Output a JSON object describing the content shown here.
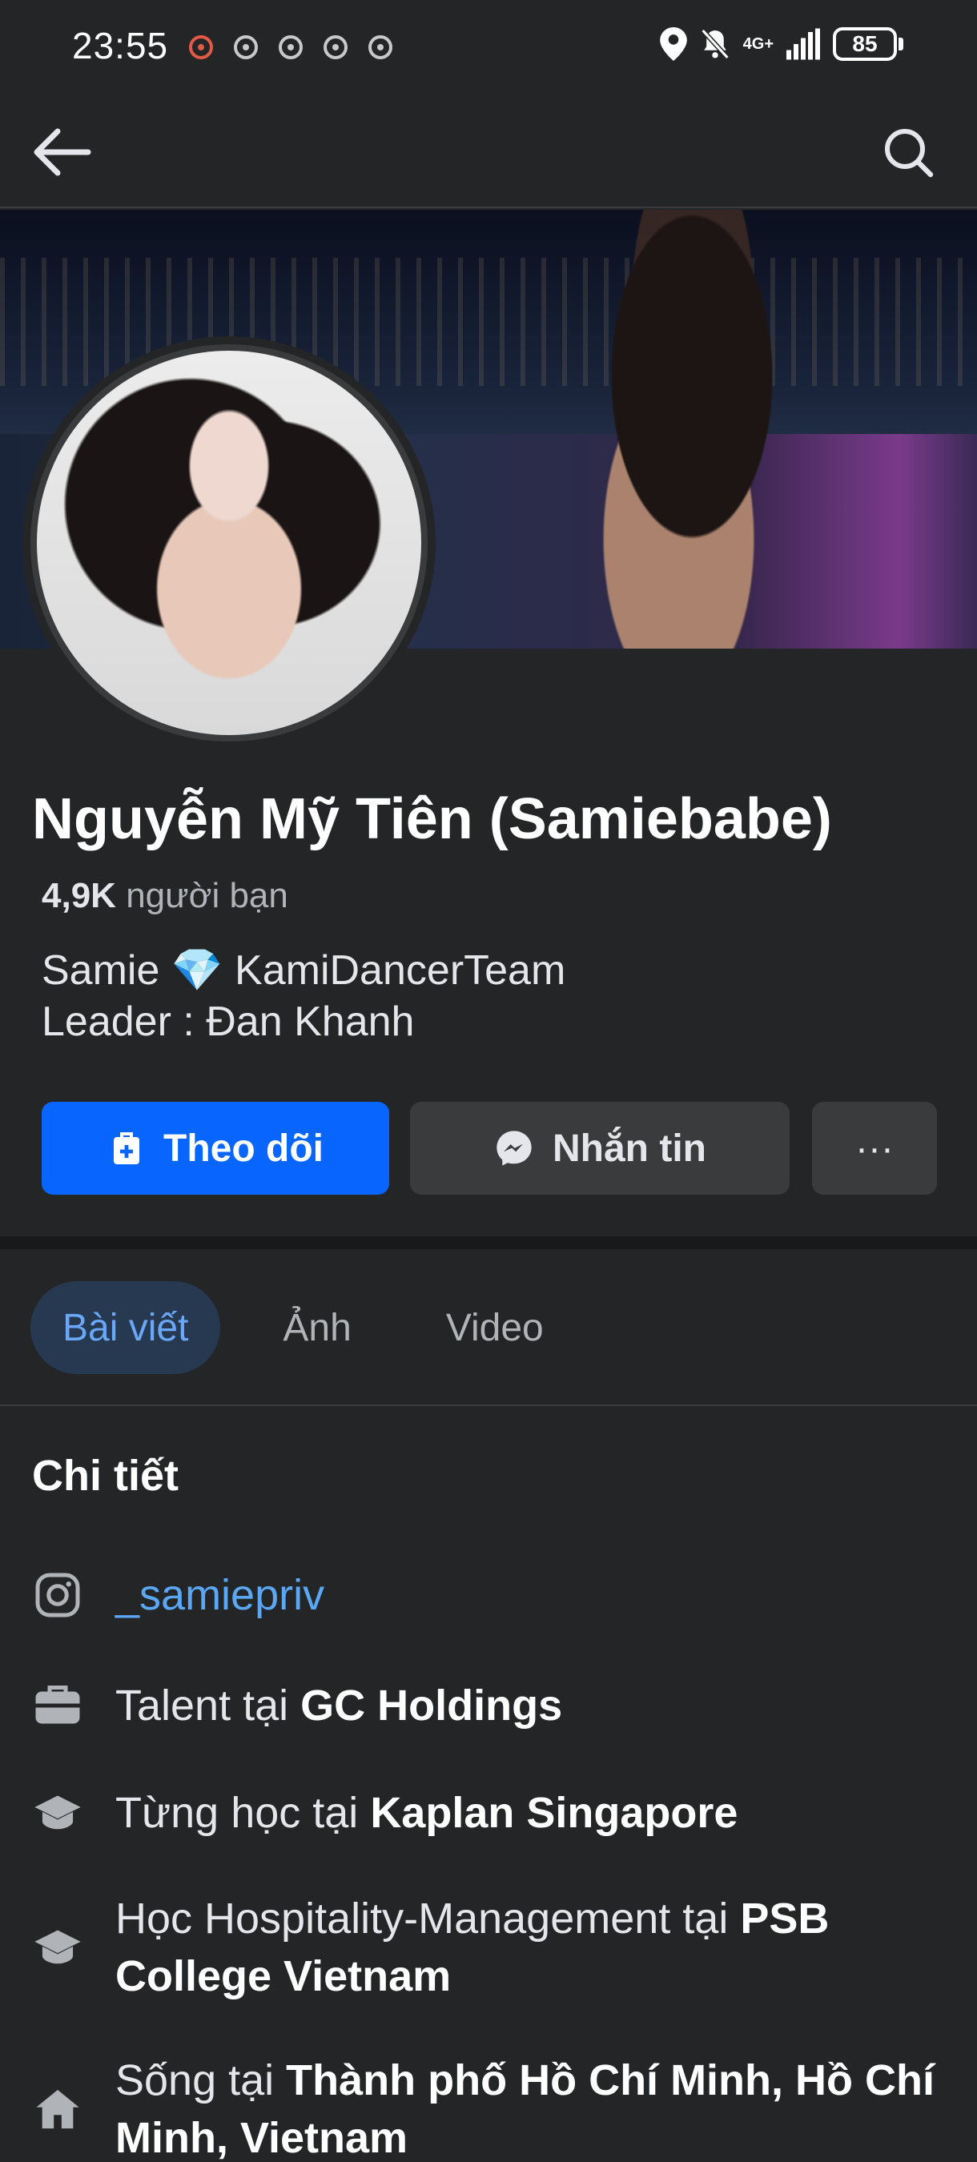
{
  "status_bar": {
    "time": "23:55",
    "network": "4G+",
    "battery": "85"
  },
  "profile": {
    "name": "Nguyễn Mỹ Tiên (Samiebabe)",
    "friends_count": "4,9K",
    "friends_label": "người bạn",
    "bio_line1": "Samie 💎 KamiDancerTeam",
    "bio_line2": "Leader : Đan Khanh"
  },
  "actions": {
    "follow_label": "Theo dõi",
    "message_label": "Nhắn tin",
    "more_label": "···"
  },
  "tabs": [
    {
      "label": "Bài viết",
      "active": true
    },
    {
      "label": "Ảnh",
      "active": false
    },
    {
      "label": "Video",
      "active": false
    }
  ],
  "details": {
    "title": "Chi tiết",
    "instagram": "_samiepriv",
    "work_prefix": "Talent tại ",
    "work_place": "GC Holdings",
    "study1_prefix": "Từng học tại ",
    "study1_place": "Kaplan Singapore",
    "study2_prefix": "Học Hospitality-Management tại ",
    "study2_place": "PSB College Vietnam",
    "live_prefix": "Sống tại ",
    "live_place": "Thành phố Hồ Chí Minh, Hồ Chí Minh, Vietnam"
  },
  "icons": {
    "back": "arrow-left-icon",
    "search": "search-icon",
    "follow": "follow-user-icon",
    "message": "messenger-icon",
    "instagram": "instagram-icon",
    "work": "briefcase-icon",
    "education": "graduation-cap-icon",
    "home": "home-icon"
  },
  "colors": {
    "background": "#242526",
    "primary_button": "#0866ff",
    "secondary_button": "#3a3b3c",
    "link": "#5aa7f5",
    "active_tab_bg": "#263951",
    "active_tab_text": "#6aa8f7"
  }
}
